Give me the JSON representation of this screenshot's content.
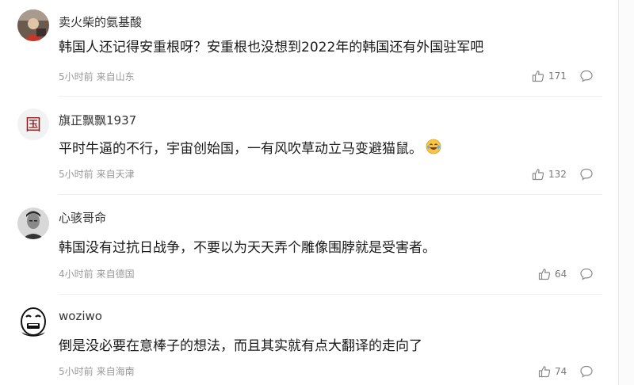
{
  "comments": [
    {
      "username": "卖火柴的氨基酸",
      "content": "韩国人还记得安重根呀？安重根也没想到2022年的韩国还有外国驻军吧",
      "time": "5小时前",
      "location": "来自山东",
      "likes": "171",
      "avatar_icon": "photo-avatar-icon"
    },
    {
      "username": "旗正飘飘1937",
      "content": "平时牛逼的不行，宇宙创始国，一有风吹草动立马变避猫鼠。",
      "emoji_icon": "laughing-tears-emoji-icon",
      "time": "5小时前",
      "location": "来自天津",
      "likes": "132",
      "avatar_glyph": "国"
    },
    {
      "username": "心骇哥命",
      "content": "韩国没有过抗日战争，不要以为天天弄个雕像围脖就是受害者。",
      "time": "4小时前",
      "location": "来自德国",
      "likes": "64",
      "avatar_icon": "portrait-avatar-icon"
    },
    {
      "username": "woziwo",
      "content": "倒是没必要在意棒子的想法，而且其实就有点大翻译的走向了",
      "time": "5小时前",
      "location": "来自海南",
      "likes": "74",
      "avatar_icon": "meme-face-avatar-icon"
    }
  ],
  "colors": {
    "text": "#1a1a1a",
    "username": "#333333",
    "meta": "#999999",
    "icon": "#777777",
    "divider": "#efefef"
  }
}
